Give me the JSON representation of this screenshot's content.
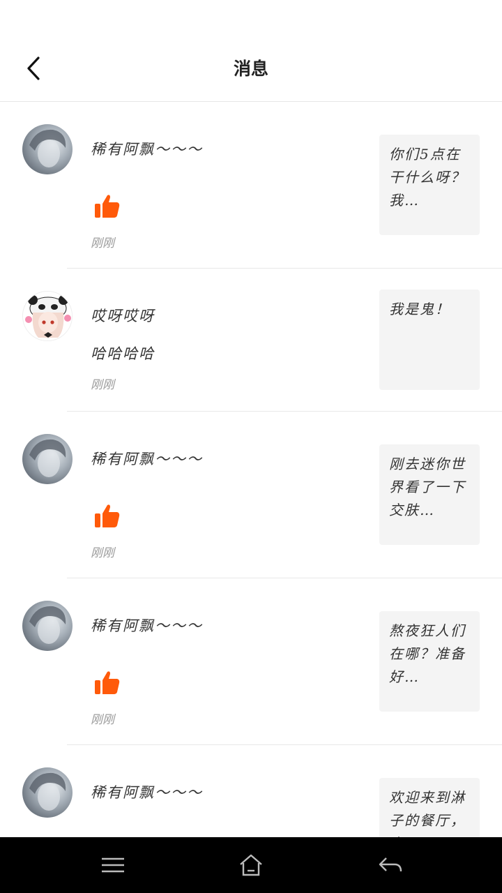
{
  "header": {
    "title": "消息"
  },
  "messages": [
    {
      "name": "稀有阿飘～～～",
      "content": "",
      "liked": true,
      "time": "刚刚",
      "preview": "你们5点在干什么呀？我…",
      "avatar": "male"
    },
    {
      "name": "哎呀哎呀",
      "content": "哈哈哈哈",
      "liked": false,
      "time": "刚刚",
      "preview": "我是鬼！",
      "avatar": "panda-girl"
    },
    {
      "name": "稀有阿飘～～～",
      "content": "",
      "liked": true,
      "time": "刚刚",
      "preview": "刚去迷你世界看了一下交肤…",
      "avatar": "male"
    },
    {
      "name": "稀有阿飘～～～",
      "content": "",
      "liked": true,
      "time": "刚刚",
      "preview": "熬夜狂人们在哪？准备好…",
      "avatar": "male"
    },
    {
      "name": "稀有阿飘～～～",
      "content": "",
      "liked": false,
      "time": "",
      "preview": "欢迎来到淋子的餐厅，点…",
      "avatar": "male"
    }
  ],
  "navbar": {
    "items": [
      "menu-icon",
      "home-icon",
      "back-icon"
    ]
  },
  "colors": {
    "like": "#ff5a0a",
    "preview_bg": "#f4f4f4",
    "divider": "#e8e8e8"
  }
}
